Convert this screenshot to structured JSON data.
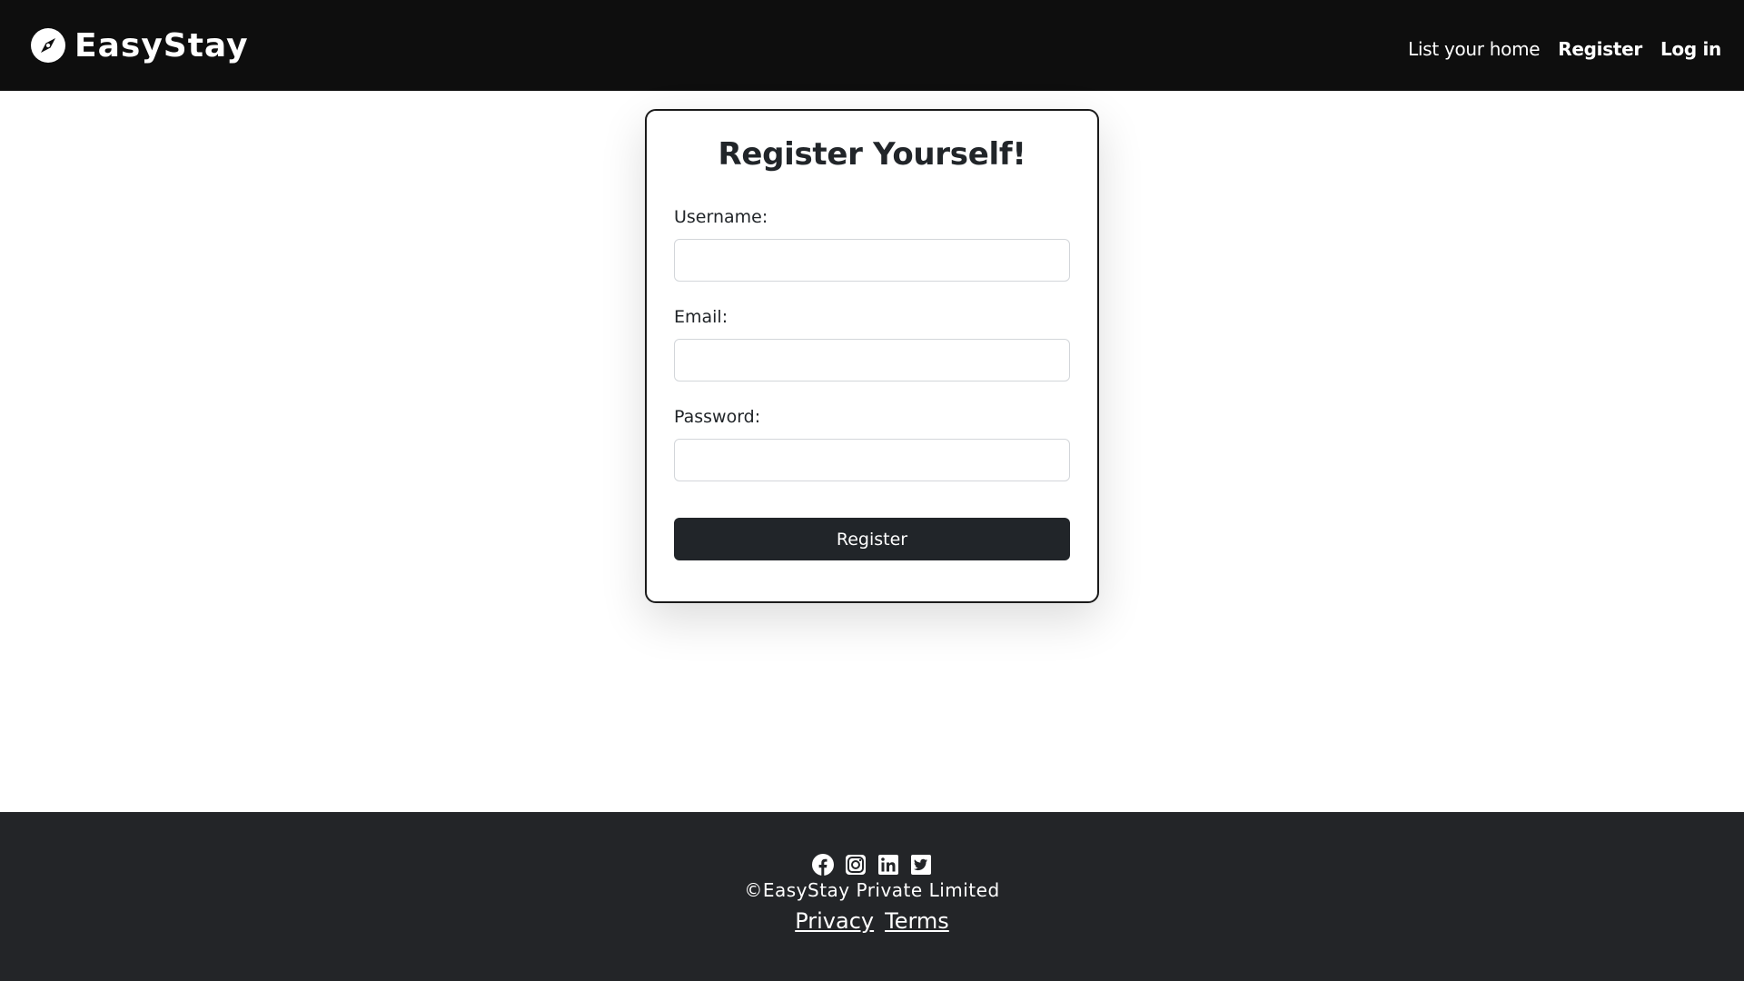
{
  "navbar": {
    "brand_name": "EasyStay",
    "brand_icon": "compass-icon",
    "links": {
      "list_home": "List your home",
      "register": "Register",
      "login": "Log in"
    }
  },
  "form": {
    "title": "Register Yourself!",
    "username_label": "Username:",
    "username_value": "",
    "email_label": "Email:",
    "email_value": "",
    "password_label": "Password:",
    "password_value": "",
    "submit_label": "Register"
  },
  "footer": {
    "social_icons": [
      "facebook-icon",
      "instagram-icon",
      "linkedin-icon",
      "twitter-icon"
    ],
    "copyright": "©EasyStay Private Limited",
    "privacy_label": "Privacy",
    "terms_label": "Terms"
  },
  "colors": {
    "navbar_bg": "#0e0e0e",
    "footer_bg": "#232528",
    "button_bg": "#212529",
    "text": "#212529"
  }
}
